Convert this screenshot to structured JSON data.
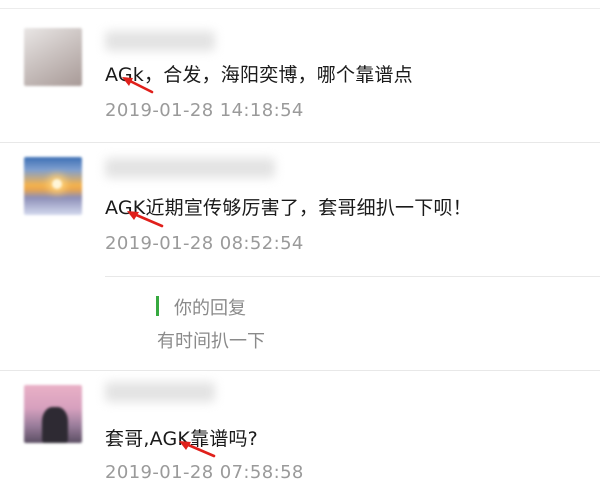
{
  "comments": [
    {
      "text": "AGk，合发，海阳奕博，哪个靠谱点",
      "time": "2019-01-28 14:18:54"
    },
    {
      "text": "AGK近期宣传够厉害了，套哥细扒一下呗！",
      "time": "2019-01-28 08:52:54",
      "reply": {
        "label": "你的回复",
        "text": "有时间扒一下"
      }
    },
    {
      "text": "套哥,AGK靠谱吗?",
      "time": "2019-01-28 07:58:58"
    }
  ],
  "colors": {
    "reply_accent": "#36a93f",
    "annotation_arrow": "#e0201b",
    "timestamp": "#9a9a9a"
  },
  "icons": [
    "annotation-arrow-icon"
  ]
}
